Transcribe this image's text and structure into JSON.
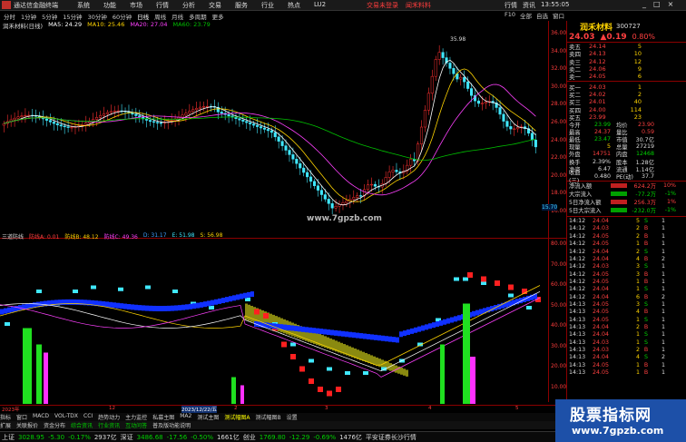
{
  "titlebar": {
    "app_title": "通达信金融终端",
    "menu": [
      "系统",
      "功能",
      "市场",
      "行情",
      "分析",
      "交易",
      "服务",
      "行业",
      "热点",
      "LU2"
    ],
    "center": [
      "交易未登录",
      "闻禾料料"
    ],
    "right": [
      "行情",
      "资讯",
      "13:55:05"
    ],
    "win": [
      "_",
      "□",
      "×"
    ]
  },
  "toolbar": {
    "items": [
      "分时",
      "1分钟",
      "5分钟",
      "15分钟",
      "30分钟",
      "60分钟",
      "日线",
      "周线",
      "月线",
      "多周期",
      "更多"
    ],
    "active_index": 6,
    "right": [
      "F10",
      "全部",
      "自选",
      "窗口"
    ]
  },
  "kinfo": {
    "name": "润禾材料(日线)",
    "ma5": "MA5: 24.29",
    "ma10": "MA10: 25.46",
    "ma20": "MA20: 27.04",
    "ma60": "MA60: 23.79"
  },
  "ind_head": {
    "name": "三道防线",
    "a": "防线A: 0.01",
    "b": "防线B: 48.12",
    "c": "防线C: 49.36",
    "d": "D: 31.17",
    "e": "E: 51.98",
    "s": "S: 56.98"
  },
  "price_axis": [
    "36.00",
    "34.00",
    "32.00",
    "30.00",
    "28.00",
    "26.00",
    "24.00",
    "22.00",
    "20.00",
    "18.00",
    "16.00"
  ],
  "peak_label": "35.98",
  "low_label": "15.70",
  "ind_axis": [
    "80.00",
    "70.00",
    "60.00",
    "50.00",
    "40.00",
    "30.00",
    "20.00",
    "10.00"
  ],
  "time_axis": [
    "2023年",
    "12",
    "2023/12/22/五",
    "2",
    "3",
    "4",
    "5"
  ],
  "tabs": [
    "指标",
    "窗口",
    "MACD",
    "VOL-TDX",
    "CCI",
    "趋势动力",
    "主力监控",
    "私募主图",
    "MA2",
    "测试主图",
    "测试幅图A",
    "测试幅图B",
    "设置"
  ],
  "tabs_active_index": 10,
  "tabs2": [
    "扩展",
    "关联报价",
    "资金分布",
    "综合资讯",
    "行业资讯",
    "互动问答",
    "普及版功能说明"
  ],
  "status": {
    "sh_label": "上证",
    "sh_val": "3028.95",
    "sh_chg": "-5.30",
    "sh_pct": "-0.17%",
    "sh_amt": "2937亿",
    "sz_label": "深证",
    "sz_val": "3486.68",
    "sz_chg": "-17.56",
    "sz_pct": "-0.50%",
    "sz_amt": "1661亿",
    "cy_label": "创业",
    "cy_val": "1769.80",
    "cy_chg": "-12.29",
    "cy_pct": "-0.69%",
    "cy_amt": "1476亿",
    "msg": "平安证券长沙行情"
  },
  "stock": {
    "name": "润禾材料",
    "code": "300727",
    "price": "24.03",
    "chg": "▲0.19",
    "pct": "0.80%"
  },
  "orderbook": {
    "sells": [
      {
        "label": "卖五",
        "price": "24.14",
        "vol": "5"
      },
      {
        "label": "卖四",
        "price": "24.13",
        "vol": "10"
      },
      {
        "label": "卖三",
        "price": "24.12",
        "vol": "12"
      },
      {
        "label": "卖二",
        "price": "24.06",
        "vol": "9"
      },
      {
        "label": "卖一",
        "price": "24.05",
        "vol": "6"
      }
    ],
    "buys": [
      {
        "label": "买一",
        "price": "24.03",
        "vol": "1"
      },
      {
        "label": "买二",
        "price": "24.02",
        "vol": "2"
      },
      {
        "label": "买三",
        "price": "24.01",
        "vol": "40"
      },
      {
        "label": "买四",
        "price": "24.00",
        "vol": "114"
      },
      {
        "label": "买五",
        "price": "23.99",
        "vol": "23"
      }
    ]
  },
  "stats": [
    {
      "k": "今开",
      "v": "23.99",
      "k2": "均价",
      "v2": "23.90"
    },
    {
      "k": "最高",
      "v": "24.37",
      "k2": "量比",
      "v2": "0.59"
    },
    {
      "k": "最低",
      "v": "23.47",
      "k2": "市值",
      "v2": "30.7亿"
    },
    {
      "k": "现量",
      "v": "5",
      "k2": "总量",
      "v2": "27219"
    },
    {
      "k": "外盘",
      "v": "14751",
      "k2": "内盘",
      "v2": "12468"
    },
    {
      "k": "换手",
      "v": "2.39%",
      "k2": "股本",
      "v2": "1.28亿"
    },
    {
      "k": "净资",
      "v": "6.47",
      "k2": "流通",
      "v2": "1.14亿"
    },
    {
      "k": "收益(三)",
      "v": "0.480",
      "k2": "PE(动)",
      "v2": "37.7"
    }
  ],
  "flows": [
    {
      "k": "净流入额",
      "v": "624.2万",
      "pct": "10%"
    },
    {
      "k": "大宗流入",
      "v": "-77.2万",
      "pct": "-1%"
    },
    {
      "k": "5日净流入额",
      "v": "256.3万",
      "pct": "1%"
    },
    {
      "k": "5日大宗流入",
      "v": "-232.0万",
      "pct": "-1%"
    }
  ],
  "ticks": [
    {
      "t": "14:12",
      "p": "24.04",
      "v": "5",
      "bs": "S",
      "n": "1"
    },
    {
      "t": "14:12",
      "p": "24.03",
      "v": "2",
      "bs": "B",
      "n": "1"
    },
    {
      "t": "14:12",
      "p": "24.05",
      "v": "2",
      "bs": "B",
      "n": "1"
    },
    {
      "t": "14:12",
      "p": "24.05",
      "v": "1",
      "bs": "B",
      "n": "1"
    },
    {
      "t": "14:12",
      "p": "24.04",
      "v": "2",
      "bs": "S",
      "n": "1"
    },
    {
      "t": "14:12",
      "p": "24.04",
      "v": "4",
      "bs": "B",
      "n": "2"
    },
    {
      "t": "14:12",
      "p": "24.03",
      "v": "3",
      "bs": "S",
      "n": "1"
    },
    {
      "t": "14:12",
      "p": "24.05",
      "v": "3",
      "bs": "B",
      "n": "1"
    },
    {
      "t": "14:12",
      "p": "24.05",
      "v": "1",
      "bs": "B",
      "n": "1"
    },
    {
      "t": "14:12",
      "p": "24.04",
      "v": "1",
      "bs": "S",
      "n": "1"
    },
    {
      "t": "14:12",
      "p": "24.04",
      "v": "6",
      "bs": "B",
      "n": "2"
    },
    {
      "t": "14:13",
      "p": "24.05",
      "v": "3",
      "bs": "S",
      "n": "1"
    },
    {
      "t": "14:13",
      "p": "24.05",
      "v": "4",
      "bs": "B",
      "n": "1"
    },
    {
      "t": "14:13",
      "p": "24.05",
      "v": "1",
      "bs": "S",
      "n": "1"
    },
    {
      "t": "14:13",
      "p": "24.04",
      "v": "2",
      "bs": "B",
      "n": "1"
    },
    {
      "t": "14:13",
      "p": "24.04",
      "v": "1",
      "bs": "S",
      "n": "1"
    },
    {
      "t": "14:13",
      "p": "24.03",
      "v": "1",
      "bs": "S",
      "n": "1"
    },
    {
      "t": "14:13",
      "p": "24.03",
      "v": "2",
      "bs": "B",
      "n": "1"
    },
    {
      "t": "14:13",
      "p": "24.04",
      "v": "4",
      "bs": "S",
      "n": "2"
    },
    {
      "t": "14:13",
      "p": "24.05",
      "v": "1",
      "bs": "B",
      "n": "1"
    },
    {
      "t": "14:13",
      "p": "24.05",
      "v": "1",
      "bs": "B",
      "n": "1"
    }
  ],
  "watermark1": "www.7gpzb.com",
  "watermark2": {
    "t1": "股票指标网",
    "t2": "www.7gpzb.com"
  },
  "colors": {
    "up": "#ff4040",
    "down": "#00d000",
    "ma5": "#ffffff",
    "ma10": "#ffd400",
    "ma20": "#ff40ff",
    "ma60": "#00c000",
    "cyan": "#40e8ff",
    "blue": "#1030ff",
    "olive": "#8a8a10"
  }
}
